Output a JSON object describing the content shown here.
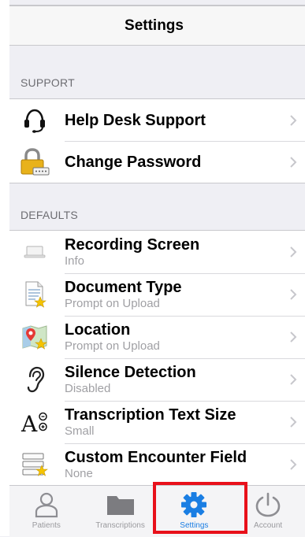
{
  "nav": {
    "title": "Settings"
  },
  "sections": {
    "support": {
      "header": "SUPPORT",
      "items": [
        {
          "title": "Help Desk Support",
          "icon": "headset-icon"
        },
        {
          "title": "Change Password",
          "icon": "lock-icon"
        }
      ]
    },
    "defaults": {
      "header": "DEFAULTS",
      "items": [
        {
          "title": "Recording Screen",
          "subtitle": "Info",
          "icon": "device-icon"
        },
        {
          "title": "Document Type",
          "subtitle": "Prompt on Upload",
          "icon": "document-star-icon"
        },
        {
          "title": "Location",
          "subtitle": "Prompt on Upload",
          "icon": "map-pin-star-icon"
        },
        {
          "title": "Silence Detection",
          "subtitle": "Disabled",
          "icon": "ear-icon"
        },
        {
          "title": "Transcription Text Size",
          "subtitle": "Small",
          "icon": "text-size-icon"
        },
        {
          "title": "Custom Encounter Field",
          "subtitle": "None",
          "icon": "form-fields-star-icon"
        }
      ]
    }
  },
  "tabbar": {
    "tabs": [
      {
        "label": "Patients",
        "icon": "person-icon"
      },
      {
        "label": "Transcriptions",
        "icon": "folder-icon"
      },
      {
        "label": "Settings",
        "icon": "gear-icon",
        "active": true
      },
      {
        "label": "Account",
        "icon": "power-icon"
      }
    ]
  },
  "colors": {
    "active_tab": "#1a7ee3",
    "highlight_box": "#e8101a",
    "background": "#efeff4"
  }
}
